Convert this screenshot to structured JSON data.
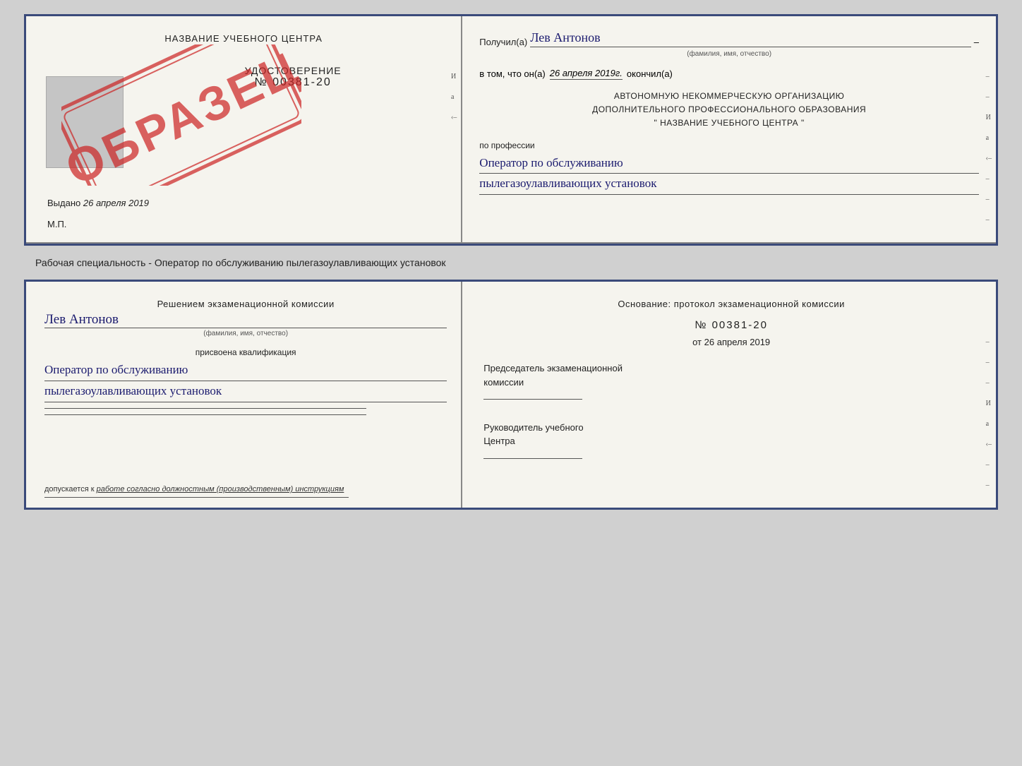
{
  "top_cert": {
    "left": {
      "title": "НАЗВАНИЕ УЧЕБНОГО ЦЕНТРА",
      "stamp_text": "ОБРАЗЕЦ",
      "udostoverenie_label": "УДОСТОВЕРЕНИЕ",
      "number": "№ 00381-20",
      "vydano_label": "Выдано",
      "vydano_date": "26 апреля 2019",
      "mp_label": "М.П."
    },
    "right": {
      "poluchil_label": "Получил(а)",
      "poluchil_name": "Лев Антонов",
      "fio_sub": "(фамилия, имя, отчество)",
      "vtom_label": "в том, что он(а)",
      "vtom_date": "26 апреля 2019г.",
      "okonchil_label": "окончил(а)",
      "anko_line1": "АВТОНОМНУЮ НЕКОММЕРЧЕСКУЮ ОРГАНИЗАЦИЮ",
      "anko_line2": "ДОПОЛНИТЕЛЬНОГО ПРОФЕССИОНАЛЬНОГО ОБРАЗОВАНИЯ",
      "anko_line3": "\"   НАЗВАНИЕ УЧЕБНОГО ЦЕНТРА   \"",
      "po_professii_label": "по профессии",
      "professiya1": "Оператор по обслуживанию",
      "professiya2": "пылегазоулавливающих установок"
    }
  },
  "subtitle": "Рабочая специальность - Оператор по обслуживанию пылегазоулавливающих установок",
  "bottom_cert": {
    "left": {
      "resheniem_label": "Решением экзаменационной комиссии",
      "name": "Лев Антонов",
      "fio_sub": "(фамилия, имя, отчество)",
      "prisvoena_label": "присвоена квалификация",
      "kvalif1": "Оператор по обслуживанию",
      "kvalif2": "пылегазоулавливающих установок",
      "dopuskaetsya_label": "допускается к",
      "dopuskaetsya_italic": "работе согласно должностным (производственным) инструкциям"
    },
    "right": {
      "osnovanie_label": "Основание: протокол экзаменационной комиссии",
      "protocol_number": "№  00381-20",
      "ot_label": "от",
      "ot_date": "26 апреля 2019",
      "predsedatel_label1": "Председатель экзаменационной",
      "predsedatel_label2": "комиссии",
      "rukovoditel_label1": "Руководитель учебного",
      "rukovoditel_label2": "Центра"
    }
  }
}
